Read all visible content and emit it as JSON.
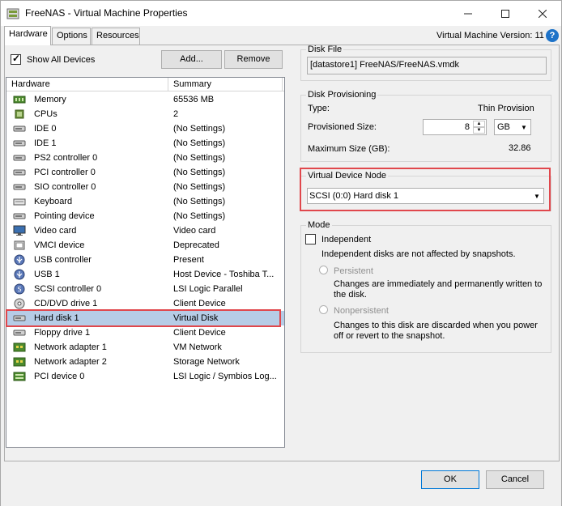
{
  "window": {
    "title": "FreeNAS - Virtual Machine Properties",
    "vm_version": "Virtual Machine Version: 11",
    "help_icon_glyph": "?"
  },
  "tabs": [
    {
      "label": "Hardware",
      "active": true
    },
    {
      "label": "Options",
      "active": false
    },
    {
      "label": "Resources",
      "active": false
    }
  ],
  "hardware_panel": {
    "show_all_devices_label": "Show All Devices",
    "show_all_devices_checked": true,
    "add_button": "Add...",
    "remove_button": "Remove",
    "columns": [
      "Hardware",
      "Summary"
    ],
    "rows": [
      {
        "name": "Memory",
        "summary": "65536 MB",
        "icon": "memory-icon"
      },
      {
        "name": "CPUs",
        "summary": "2",
        "icon": "cpu-icon"
      },
      {
        "name": "IDE 0",
        "summary": "(No Settings)",
        "icon": "ide-icon"
      },
      {
        "name": "IDE 1",
        "summary": "(No Settings)",
        "icon": "ide-icon"
      },
      {
        "name": "PS2 controller 0",
        "summary": "(No Settings)",
        "icon": "controller-icon"
      },
      {
        "name": "PCI controller 0",
        "summary": "(No Settings)",
        "icon": "controller-icon"
      },
      {
        "name": "SIO controller 0",
        "summary": "(No Settings)",
        "icon": "controller-icon"
      },
      {
        "name": "Keyboard",
        "summary": "(No Settings)",
        "icon": "keyboard-icon"
      },
      {
        "name": "Pointing device",
        "summary": "(No Settings)",
        "icon": "mouse-icon"
      },
      {
        "name": "Video card",
        "summary": "Video card",
        "icon": "monitor-icon"
      },
      {
        "name": "VMCI device",
        "summary": "Deprecated",
        "icon": "vmci-icon"
      },
      {
        "name": "USB controller",
        "summary": "Present",
        "icon": "usb-icon"
      },
      {
        "name": "USB 1",
        "summary": "Host Device - Toshiba T...",
        "icon": "usb-icon"
      },
      {
        "name": "SCSI controller 0",
        "summary": "LSI Logic Parallel",
        "icon": "scsi-icon"
      },
      {
        "name": "CD/DVD drive 1",
        "summary": "Client Device",
        "icon": "cd-icon"
      },
      {
        "name": "Hard disk 1",
        "summary": "Virtual Disk",
        "icon": "disk-icon",
        "selected": true
      },
      {
        "name": "Floppy drive 1",
        "summary": "Client Device",
        "icon": "floppy-icon"
      },
      {
        "name": "Network adapter 1",
        "summary": "VM Network",
        "icon": "network-icon"
      },
      {
        "name": "Network adapter 2",
        "summary": "Storage Network",
        "icon": "network-icon"
      },
      {
        "name": "PCI device 0",
        "summary": "LSI Logic / Symbios Log...",
        "icon": "pci-icon"
      }
    ]
  },
  "disk_file": {
    "legend": "Disk File",
    "path": "[datastore1] FreeNAS/FreeNAS.vmdk"
  },
  "disk_provisioning": {
    "legend": "Disk Provisioning",
    "type_label": "Type:",
    "type_value": "Thin Provision",
    "provisioned_label": "Provisioned Size:",
    "provisioned_value": "8",
    "unit": "GB",
    "max_label": "Maximum Size (GB):",
    "max_value": "32.86"
  },
  "virtual_device_node": {
    "legend": "Virtual Device Node",
    "selected": "SCSI (0:0) Hard disk 1"
  },
  "mode": {
    "legend": "Mode",
    "independent_label": "Independent",
    "independent_checked": false,
    "independent_desc": "Independent disks are not affected by snapshots.",
    "persistent_label": "Persistent",
    "persistent_desc": "Changes are immediately and permanently written to the disk.",
    "nonpersistent_label": "Nonpersistent",
    "nonpersistent_desc": "Changes to this disk are discarded when you power off or revert to the snapshot."
  },
  "footer": {
    "ok": "OK",
    "cancel": "Cancel"
  },
  "colors": {
    "selection": "#b6cce6",
    "highlight_box": "#e0474c",
    "accent": "#0078d7"
  }
}
